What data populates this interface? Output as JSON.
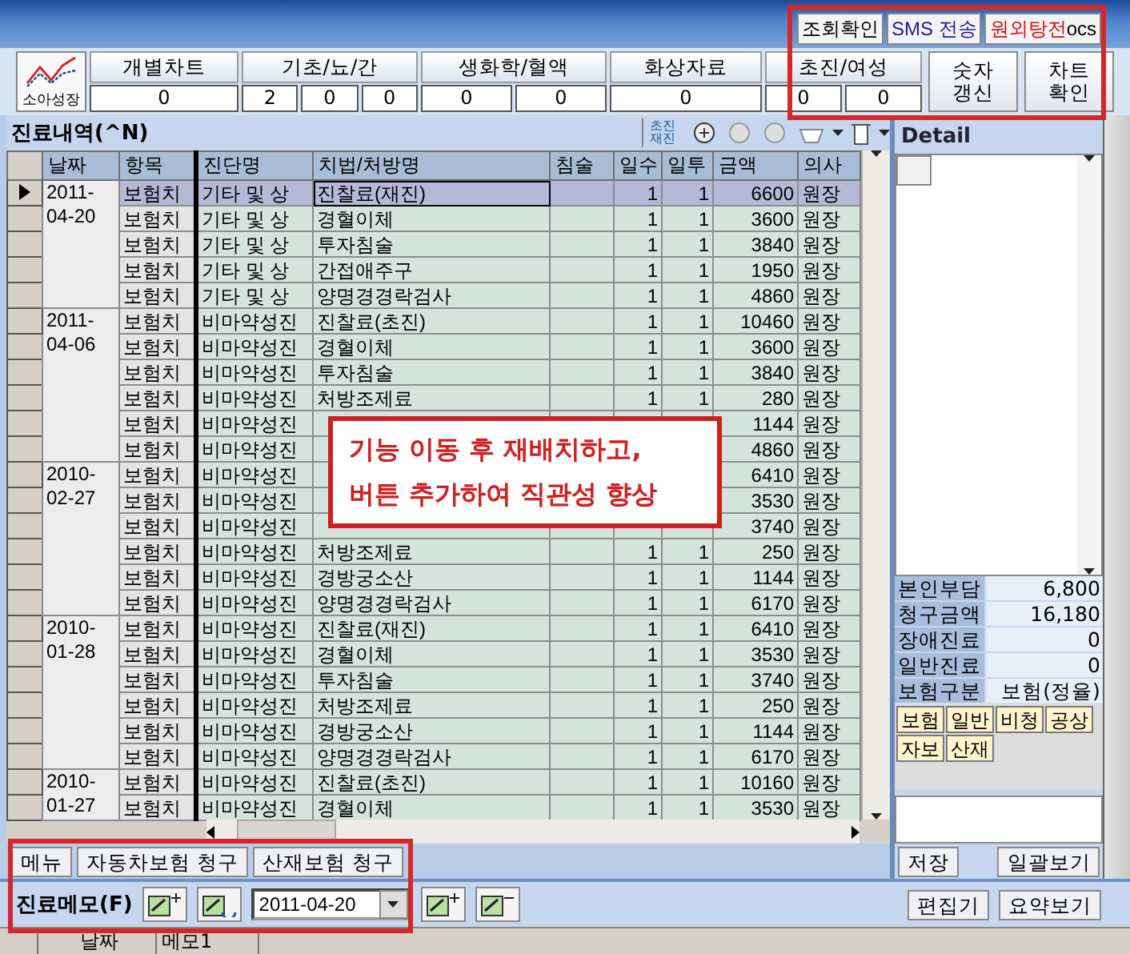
{
  "top_buttons": [
    {
      "label": "조회확인",
      "color": "#000000"
    },
    {
      "label": "SMS 전송",
      "color": "#1a1aa0"
    },
    {
      "label": "원외탕전",
      "color": "#d01010",
      "suffix": "ocs"
    }
  ],
  "growth_button": {
    "label": "소아성장"
  },
  "summary_tabs": [
    {
      "label": "개별차트",
      "counts": [
        "0"
      ]
    },
    {
      "label": "기초/뇨/간",
      "counts": [
        "2",
        "0",
        "0"
      ]
    },
    {
      "label": "생화학/혈액",
      "counts": [
        "0",
        "0"
      ]
    },
    {
      "label": "화상자료",
      "counts": [
        "0"
      ]
    },
    {
      "label": "초진/여성",
      "counts": [
        "0",
        "0"
      ]
    }
  ],
  "action_buttons": [
    {
      "lines": [
        "숫자",
        "갱신"
      ]
    },
    {
      "lines": [
        "차트",
        "확인"
      ]
    }
  ],
  "history": {
    "title": "진료내역(^N)",
    "visit_toggle": [
      "초진",
      "재진"
    ],
    "columns": [
      "날짜",
      "항목",
      "진단명",
      "치법/처방명",
      "침술",
      "일수",
      "일투",
      "금액",
      "의사"
    ],
    "groups": [
      {
        "date": "2011-04-20",
        "rows": [
          {
            "selected": true,
            "item": "보험치",
            "diagnosis": "기타 및 상",
            "prescription": "진찰료(재진)",
            "days": "1",
            "doses": "1",
            "amount": "6600",
            "doctor": "원장"
          },
          {
            "selected": false,
            "item": "보험치",
            "diagnosis": "기타 및 상",
            "prescription": "경혈이체",
            "days": "1",
            "doses": "1",
            "amount": "3600",
            "doctor": "원장"
          },
          {
            "selected": false,
            "item": "보험치",
            "diagnosis": "기타 및 상",
            "prescription": "투자침술",
            "days": "1",
            "doses": "1",
            "amount": "3840",
            "doctor": "원장"
          },
          {
            "selected": false,
            "item": "보험치",
            "diagnosis": "기타 및 상",
            "prescription": "간접애주구",
            "days": "1",
            "doses": "1",
            "amount": "1950",
            "doctor": "원장"
          },
          {
            "selected": false,
            "item": "보험치",
            "diagnosis": "기타 및 상",
            "prescription": "양명경경락검사",
            "days": "1",
            "doses": "1",
            "amount": "4860",
            "doctor": "원장"
          }
        ]
      },
      {
        "date": "2011-04-06",
        "rows": [
          {
            "selected": false,
            "item": "보험치",
            "diagnosis": "비마약성진",
            "prescription": "진찰료(초진)",
            "days": "1",
            "doses": "1",
            "amount": "10460",
            "doctor": "원장"
          },
          {
            "selected": false,
            "item": "보험치",
            "diagnosis": "비마약성진",
            "prescription": "경혈이체",
            "days": "1",
            "doses": "1",
            "amount": "3600",
            "doctor": "원장"
          },
          {
            "selected": false,
            "item": "보험치",
            "diagnosis": "비마약성진",
            "prescription": "투자침술",
            "days": "1",
            "doses": "1",
            "amount": "3840",
            "doctor": "원장"
          },
          {
            "selected": false,
            "item": "보험치",
            "diagnosis": "비마약성진",
            "prescription": "처방조제료",
            "days": "1",
            "doses": "1",
            "amount": "280",
            "doctor": "원장"
          },
          {
            "selected": false,
            "item": "보험치",
            "diagnosis": "비마약성진",
            "amount": "1144",
            "doctor": "원장"
          },
          {
            "selected": false,
            "item": "보험치",
            "diagnosis": "비마약성진",
            "amount": "4860",
            "doctor": "원장"
          }
        ]
      },
      {
        "date": "2010-02-27",
        "rows": [
          {
            "selected": false,
            "item": "보험치",
            "diagnosis": "비마약성진",
            "amount": "6410",
            "doctor": "원장"
          },
          {
            "selected": false,
            "item": "보험치",
            "diagnosis": "비마약성진",
            "amount": "3530",
            "doctor": "원장"
          },
          {
            "selected": false,
            "item": "보험치",
            "diagnosis": "비마약성진",
            "amount": "3740",
            "doctor": "원장"
          },
          {
            "selected": false,
            "item": "보험치",
            "diagnosis": "비마약성진",
            "prescription": "처방조제료",
            "days": "1",
            "doses": "1",
            "amount": "250",
            "doctor": "원장"
          },
          {
            "selected": false,
            "item": "보험치",
            "diagnosis": "비마약성진",
            "prescription": "경방궁소산",
            "days": "1",
            "doses": "1",
            "amount": "1144",
            "doctor": "원장"
          },
          {
            "selected": false,
            "item": "보험치",
            "diagnosis": "비마약성진",
            "prescription": "양명경경락검사",
            "days": "1",
            "doses": "1",
            "amount": "6170",
            "doctor": "원장"
          }
        ]
      },
      {
        "date": "2010-01-28",
        "rows": [
          {
            "selected": false,
            "item": "보험치",
            "diagnosis": "비마약성진",
            "prescription": "진찰료(재진)",
            "days": "1",
            "doses": "1",
            "amount": "6410",
            "doctor": "원장"
          },
          {
            "selected": false,
            "item": "보험치",
            "diagnosis": "비마약성진",
            "prescription": "경혈이체",
            "days": "1",
            "doses": "1",
            "amount": "3530",
            "doctor": "원장"
          },
          {
            "selected": false,
            "item": "보험치",
            "diagnosis": "비마약성진",
            "prescription": "투자침술",
            "days": "1",
            "doses": "1",
            "amount": "3740",
            "doctor": "원장"
          },
          {
            "selected": false,
            "item": "보험치",
            "diagnosis": "비마약성진",
            "prescription": "처방조제료",
            "days": "1",
            "doses": "1",
            "amount": "250",
            "doctor": "원장"
          },
          {
            "selected": false,
            "item": "보험치",
            "diagnosis": "비마약성진",
            "prescription": "경방궁소산",
            "days": "1",
            "doses": "1",
            "amount": "1144",
            "doctor": "원장"
          },
          {
            "selected": false,
            "item": "보험치",
            "diagnosis": "비마약성진",
            "prescription": "양명경경락검사",
            "days": "1",
            "doses": "1",
            "amount": "6170",
            "doctor": "원장"
          }
        ]
      },
      {
        "date": "2010-01-27",
        "rows": [
          {
            "selected": false,
            "item": "보험치",
            "diagnosis": "비마약성진",
            "prescription": "진찰료(초진)",
            "days": "1",
            "doses": "1",
            "amount": "10160",
            "doctor": "원장"
          },
          {
            "selected": false,
            "item": "보험치",
            "diagnosis": "비마약성진",
            "prescription": "경혈이체",
            "days": "1",
            "doses": "1",
            "amount": "3530",
            "doctor": "원장"
          }
        ]
      }
    ]
  },
  "callout": {
    "lines": [
      "기능 이동 후 재배치하고,",
      "버튼 추가하여 직관성 향상"
    ]
  },
  "detail": {
    "title": "Detail",
    "summary": [
      {
        "label": "본인부담",
        "value": "6,800"
      },
      {
        "label": "청구금액",
        "value": "16,180"
      },
      {
        "label": "장애진료",
        "value": "0"
      },
      {
        "label": "일반진료",
        "value": "0"
      },
      {
        "label": "보험구분",
        "value": "보험(정율)"
      }
    ],
    "insurance_buttons": [
      "보험",
      "일반",
      "비청",
      "공상",
      "자보",
      "산재"
    ],
    "buttons": [
      "저장",
      "일괄보기"
    ]
  },
  "bottom_buttons": [
    "메뉴",
    "자동차보험 청구",
    "산재보험 청구"
  ],
  "memo": {
    "title": "진료메모(F)",
    "date": "2011-04-20",
    "buttons": [
      "편집기",
      "요약보기"
    ],
    "columns": [
      "날짜",
      "메모1"
    ]
  }
}
